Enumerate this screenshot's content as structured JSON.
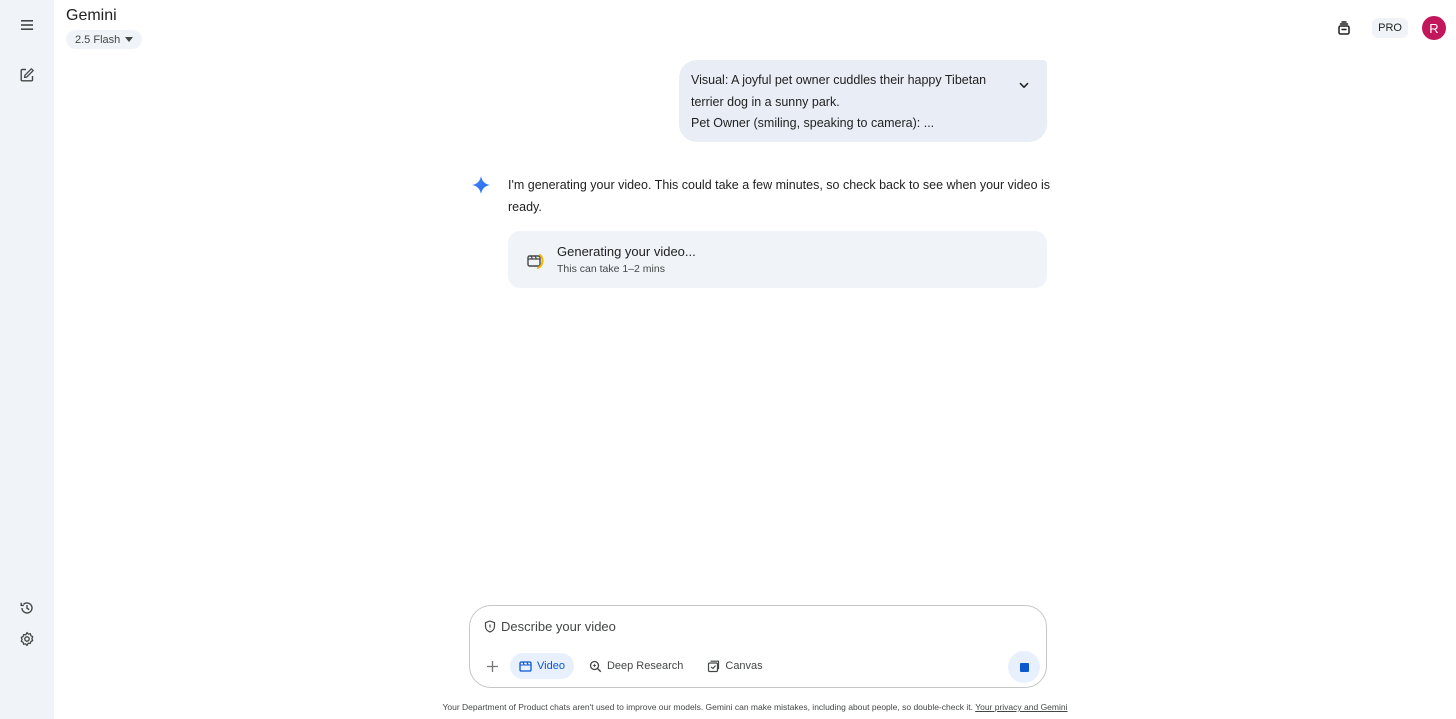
{
  "app": {
    "title": "Gemini",
    "model": "2.5 Flash"
  },
  "header": {
    "plan_badge": "PRO",
    "avatar_initial": "R"
  },
  "rail": {
    "icons": [
      "menu-icon",
      "new-chat-icon",
      "history-icon",
      "settings-icon"
    ]
  },
  "conversation": {
    "user_message": {
      "line1": "Visual: A joyful pet owner cuddles their happy Tibetan terrier dog in a sunny park.",
      "line2": "Pet Owner (smiling, speaking to camera): ..."
    },
    "response_text": "I'm generating your video. This could take a few minutes, so check back to see when your video is ready.",
    "generation_card": {
      "title": "Generating your video...",
      "subtitle": "This can take 1–2 mins"
    }
  },
  "composer": {
    "placeholder": "Describe your video",
    "tools": [
      {
        "label": "Video",
        "active": true
      },
      {
        "label": "Deep Research",
        "active": false
      },
      {
        "label": "Canvas",
        "active": false
      }
    ]
  },
  "footer": {
    "disclaimer": "Your Department of Product chats aren't used to improve our models. Gemini can make mistakes, including about people, so double-check it.",
    "link": "Your privacy and Gemini"
  },
  "colors": {
    "accent": "#0b57d0",
    "rail_bg": "#f0f4f9",
    "bubble_bg": "#e9eef6",
    "avatar_bg": "#c2185b"
  }
}
